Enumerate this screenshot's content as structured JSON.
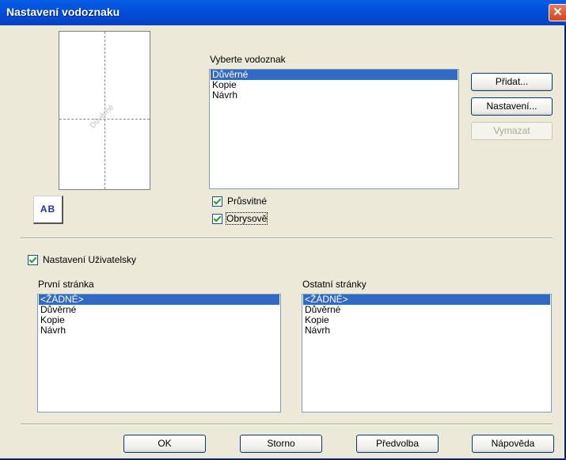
{
  "window": {
    "title": "Nastavení vodoznaku",
    "close_label": "✕"
  },
  "preview": {
    "watermark_text": "Důvěrné",
    "ab_label": "AB"
  },
  "watermark_list": {
    "label": "Vyberte vodoznak",
    "items": [
      "Důvěrné",
      "Kopie",
      "Návrh"
    ],
    "selected": "Důvěrné"
  },
  "side_buttons": {
    "add": "Přidat...",
    "settings": "Nastavení...",
    "delete": "Vymazat"
  },
  "options": {
    "transparent": "Průsvitné",
    "outline": "Obrysově"
  },
  "custom": {
    "label": "Nastavení Uživatelsky"
  },
  "first_page": {
    "label": "První stránka",
    "items": [
      "<ŽÁDNÉ>",
      "Důvěrné",
      "Kopie",
      "Návrh"
    ],
    "selected": "<ŽÁDNÉ>"
  },
  "other_pages": {
    "label": "Ostatní stránky",
    "items": [
      "<ŽÁDNÉ>",
      "Důvěrné",
      "Kopie",
      "Návrh"
    ],
    "selected": "<ŽÁDNÉ>"
  },
  "footer": {
    "ok": "OK",
    "cancel": "Storno",
    "default": "Předvolba",
    "help": "Nápověda"
  }
}
